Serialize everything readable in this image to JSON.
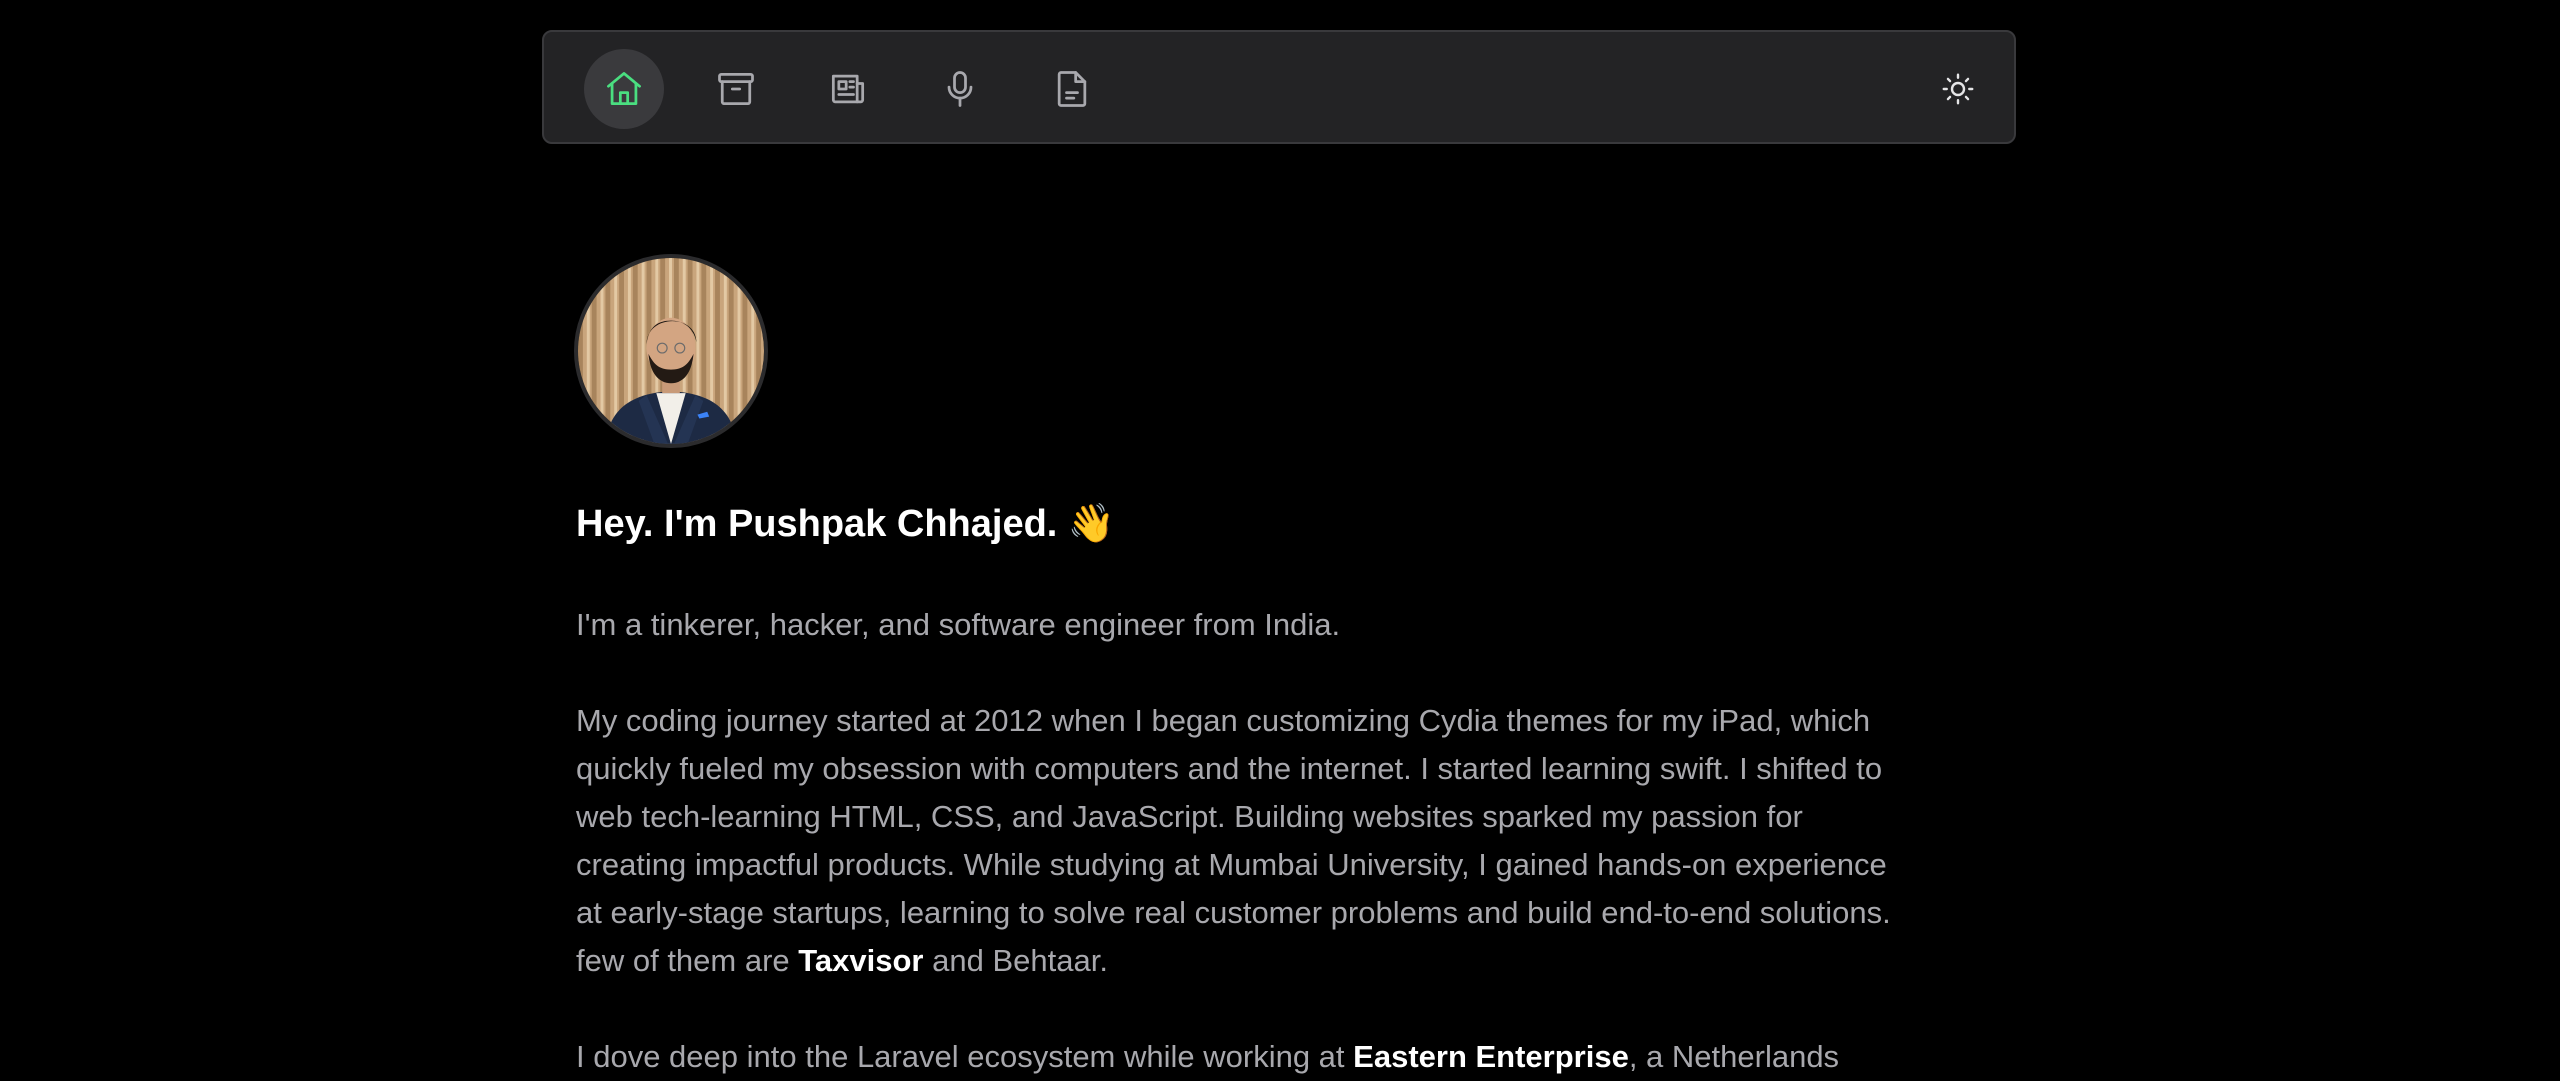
{
  "nav": {
    "items": [
      {
        "name": "home-icon",
        "active": true
      },
      {
        "name": "archive-icon",
        "active": false
      },
      {
        "name": "newspaper-icon",
        "active": false
      },
      {
        "name": "microphone-icon",
        "active": false
      },
      {
        "name": "document-icon",
        "active": false
      }
    ],
    "theme_toggle_icon": "sun-icon",
    "active_color": "#4ade80",
    "icon_color": "#a8a8ad"
  },
  "profile": {
    "title": "Hey. I'm Pushpak Chhajed. 👋",
    "intro": "I'm a tinkerer, hacker, and software engineer from India.",
    "journey_lines": [
      "My coding journey started at 2012 when I began customizing Cydia themes for my iPad, which",
      "quickly fueled my obsession with computers and the internet. I started learning swift. I shifted to",
      "web tech-learning HTML, CSS, and JavaScript. Building websites sparked my passion for",
      "creating impactful products. While studying at Mumbai University, I gained hands-on experience",
      "at early-stage startups, learning to solve real customer problems and build end-to-end solutions."
    ],
    "journey_last_before": "few of them are ",
    "journey_last_bold": "Taxvisor",
    "journey_last_after": " and Behtaar.",
    "next_before": "I dove deep into the Laravel ecosystem while working at ",
    "next_bold": "Eastern Enterprise",
    "next_after": ", a Netherlands"
  }
}
